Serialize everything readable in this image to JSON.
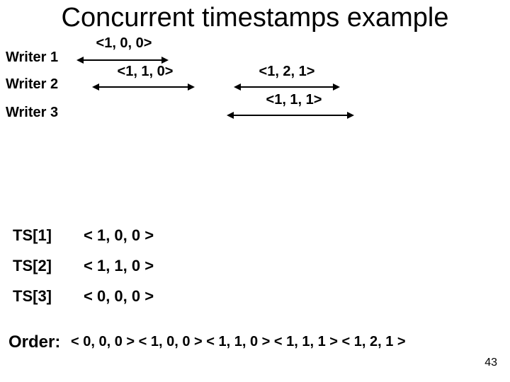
{
  "title": "Concurrent timestamps example",
  "writers": {
    "w1": "Writer 1",
    "w2": "Writer 2",
    "w3": "Writer 3"
  },
  "timeline": {
    "w1_a": "<1, 0, 0>",
    "w2_a": "<1, 1, 0>",
    "w2_b": "<1, 2, 1>",
    "w3_a": "<1, 1, 1>"
  },
  "ts_table": {
    "row1_label": "TS[1]",
    "row1_value": "< 1, 0, 0 >",
    "row2_label": "TS[2]",
    "row2_value": "< 1, 1, 0 >",
    "row3_label": "TS[3]",
    "row3_value": "< 0, 0, 0 >"
  },
  "order": {
    "label": "Order:",
    "seq": "< 0, 0, 0 >  < 1, 0, 0 >  < 1, 1, 0 >  < 1, 1, 1 >   < 1, 2, 1 >"
  },
  "page_number": "43"
}
